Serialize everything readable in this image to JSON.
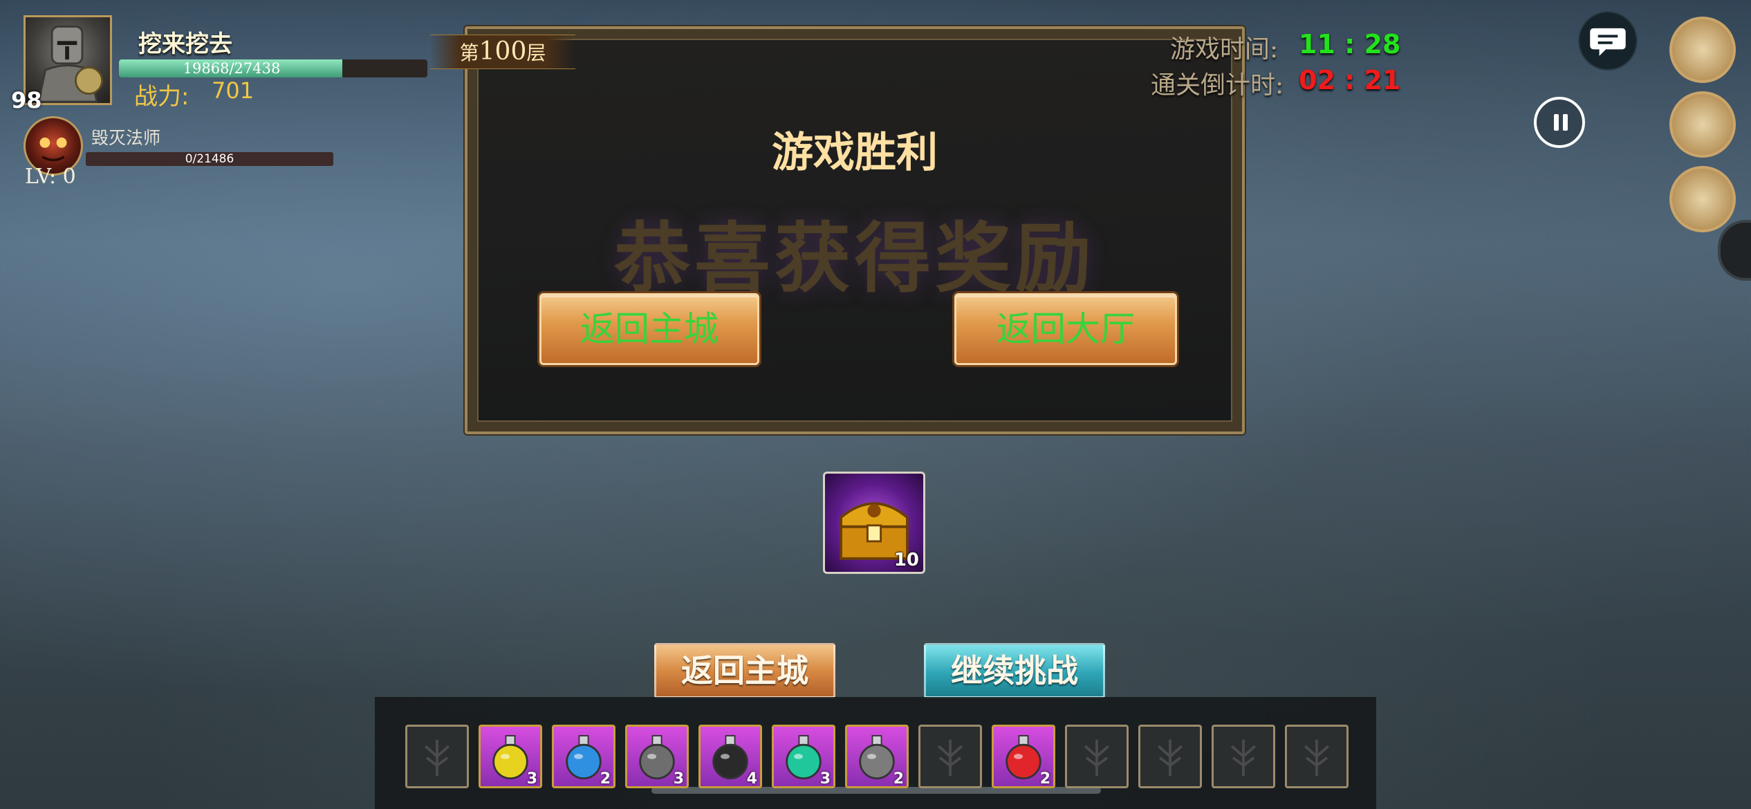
{
  "player": {
    "name": "挖来挖去",
    "level": "98",
    "hp_text": "19868/27438",
    "hp_fraction": 0.724,
    "power_label": "战力:",
    "power_value": "701"
  },
  "boss": {
    "name": "毁灭法师",
    "hp_text": "0/21486",
    "level": "LV: 0"
  },
  "floor": {
    "prefix": "第",
    "number": "100",
    "suffix": "层"
  },
  "timers": {
    "game_time_label": "游戏时间:",
    "game_time_value": "11 : 28",
    "game_time_color": "#23e21b",
    "countdown_label": "通关倒计时:",
    "countdown_value": "02 : 21",
    "countdown_color": "#ef1c1c"
  },
  "victory": {
    "title": "游戏胜利",
    "reward_text": "恭喜获得奖励",
    "btn_return_city": "返回主城",
    "btn_return_lobby": "返回大厅"
  },
  "reward_item": {
    "icon": "treasure-chest-icon",
    "count": "10"
  },
  "bottom_buttons": {
    "return_city": "返回主城",
    "continue": "继续挑战"
  },
  "inventory": [
    {
      "type": "empty"
    },
    {
      "type": "potion",
      "color": "#e7d21f",
      "count": "3"
    },
    {
      "type": "potion",
      "color": "#2f8fe0",
      "count": "2"
    },
    {
      "type": "potion",
      "color": "#6e6e6e",
      "count": "3"
    },
    {
      "type": "potion",
      "color": "#2a2a2a",
      "count": "4"
    },
    {
      "type": "potion",
      "color": "#1fc79a",
      "count": "3"
    },
    {
      "type": "potion",
      "color": "#7c7c7c",
      "count": "2"
    },
    {
      "type": "empty"
    },
    {
      "type": "potion",
      "color": "#e0262a",
      "count": "2"
    },
    {
      "type": "empty"
    },
    {
      "type": "empty"
    },
    {
      "type": "empty"
    },
    {
      "type": "empty"
    }
  ],
  "side_icons": [
    "warrior-avatar-icon",
    "horned-helmet-icon",
    "crossed-tools-icon"
  ]
}
